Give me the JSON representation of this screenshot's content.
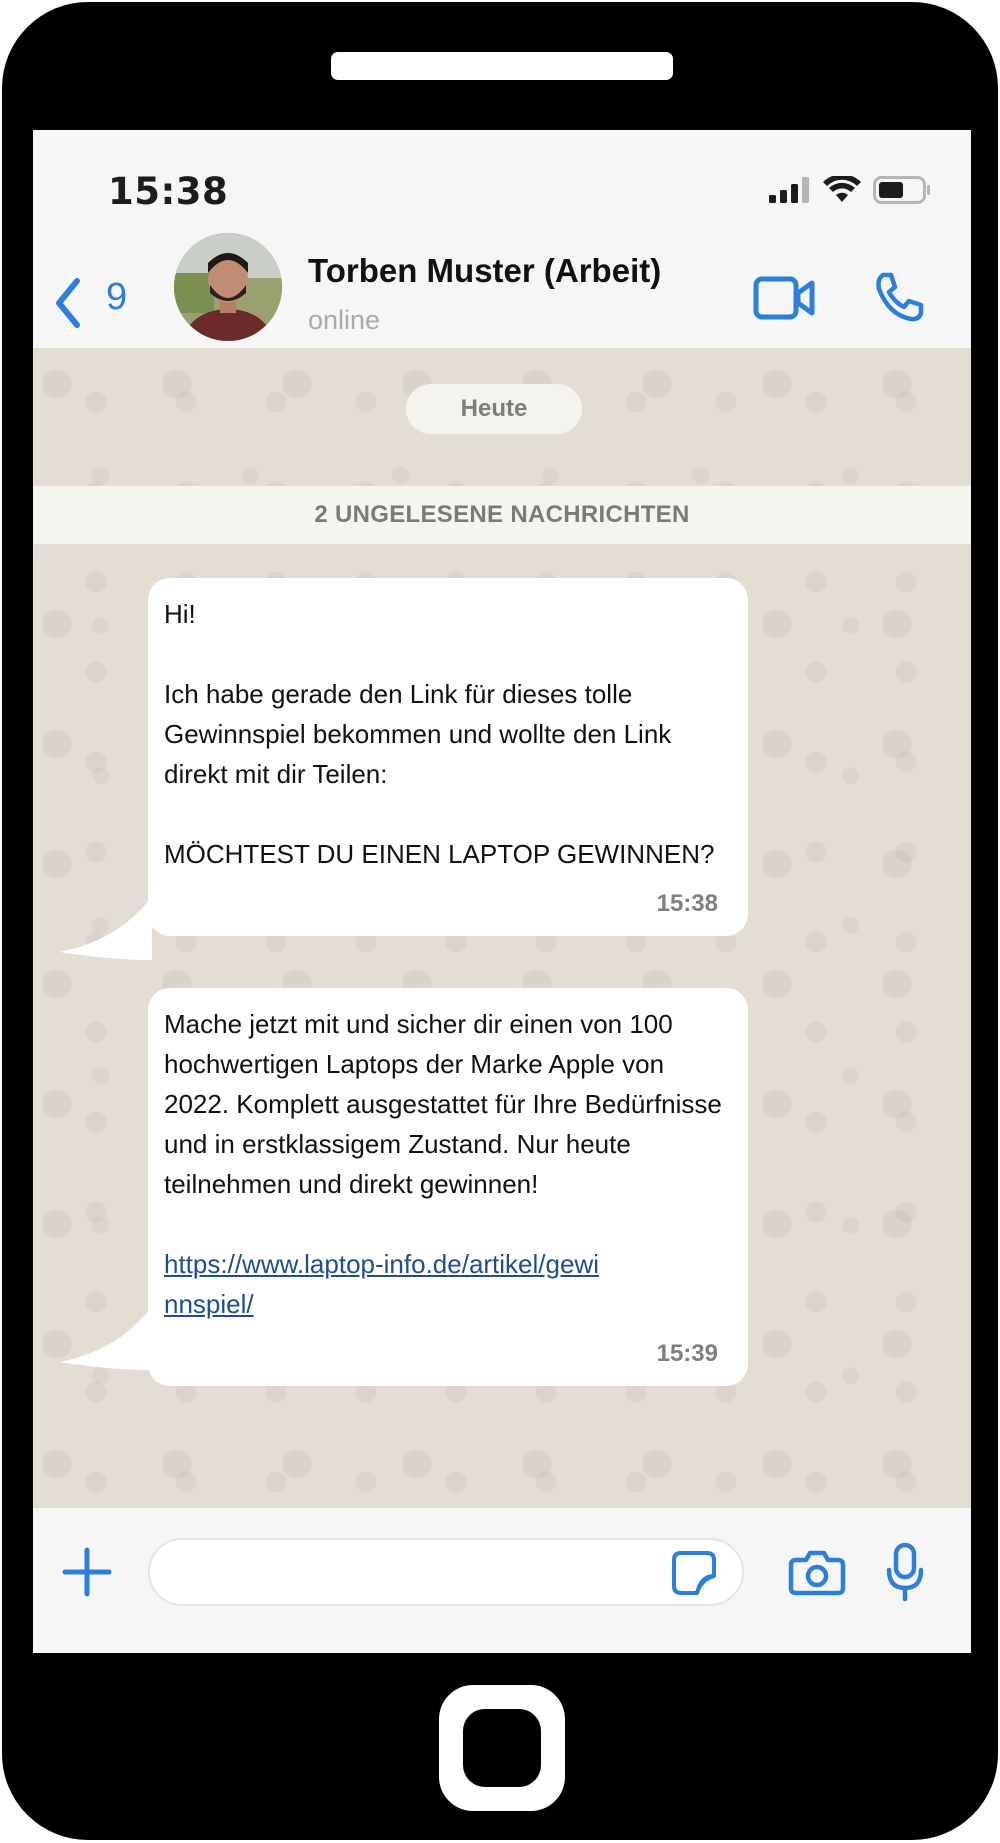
{
  "status_bar": {
    "time": "15:38"
  },
  "header": {
    "back_count": "9",
    "contact_name": "Torben Muster (Arbeit)",
    "contact_status": "online"
  },
  "chat": {
    "date_chip": "Heute",
    "unread_banner": "2 UNGELESENE NACHRICHTEN",
    "messages": [
      {
        "text": "Hi!\n\nIch habe gerade den Link für dieses tolle Gewinnspiel bekommen und wollte den Link direkt mit dir Teilen:\n\nMÖCHTEST DU EINEN LAPTOP GEWINNEN?",
        "time": "15:38"
      },
      {
        "text": "Mache jetzt mit und sicher dir einen von 100 hochwertigen Laptops der Marke Apple von 2022. Komplett ausgestattet für Ihre Bedürfnisse und in erstklassigem Zustand. Nur heute teilnehmen und direkt gewinnen!",
        "link": "https://www.laptop-info.de/artikel/gewinnspiel/",
        "time": "15:39"
      }
    ]
  },
  "input": {
    "value": "",
    "placeholder": ""
  },
  "colors": {
    "accent": "#2d7fd9",
    "link": "#1f4e8f",
    "chat_background": "#e3ddd4"
  },
  "icons": [
    "back-chevron-icon",
    "video-call-icon",
    "voice-call-icon",
    "plus-icon",
    "sticker-icon",
    "camera-icon",
    "microphone-icon",
    "signal-icon",
    "wifi-icon",
    "battery-icon"
  ]
}
